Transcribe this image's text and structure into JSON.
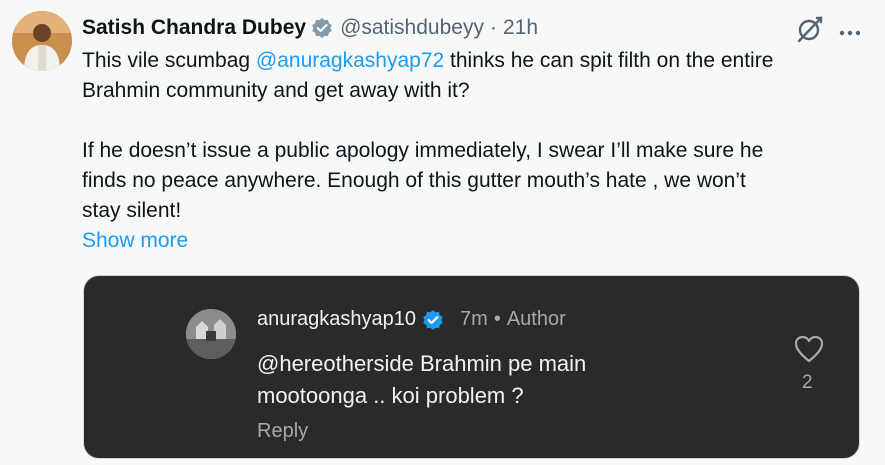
{
  "author": {
    "display_name": "Satish Chandra Dubey",
    "handle": "@satishdubeyy",
    "separator": "·",
    "time": "21h",
    "verified_color": "#829aab"
  },
  "icons": {
    "avatar": "profile-photo",
    "verified": "verified-badge-icon",
    "grok": "grok-icon",
    "more": "more-icon",
    "like": "heart-icon"
  },
  "tweet": {
    "line1_pre": "This vile scumbag ",
    "line1_mention": "@anuragkashyap72",
    "line1_post": " thinks he can spit filth on the entire",
    "line2": "Brahmin community and get away with it?",
    "line3": "If he doesn’t issue a public apology immediately, I swear I’ll make sure he",
    "line4": "finds no peace anywhere. Enough of this gutter mouth’s hate , we won’t",
    "line5": "stay silent!",
    "show_more": "Show more"
  },
  "media": {
    "username": "anuragkashyap10",
    "time": "7m",
    "separator": "•",
    "role": "Author",
    "text_line1": "@hereotherside Brahmin pe main",
    "text_line2": "mootoonga .. koi problem ?",
    "reply": "Reply",
    "like_count": "2",
    "verified_color": "#1d9bf0"
  },
  "colors": {
    "accent": "#1d9bf0",
    "background": "#f7f9f9",
    "media_background": "#2a2a2a"
  }
}
